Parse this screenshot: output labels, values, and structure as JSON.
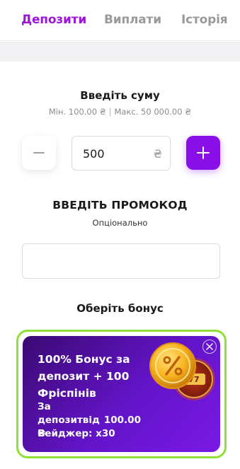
{
  "tabs": [
    {
      "label": "Депозити",
      "active": true
    },
    {
      "label": "Виплати",
      "active": false
    },
    {
      "label": "Історія",
      "active": false
    }
  ],
  "amount": {
    "title": "Введіть суму",
    "min_label": "Мін.  100.00 ₴",
    "max_label": "Макс.  50 000.00 ₴",
    "value": "500",
    "currency": "₴"
  },
  "promo": {
    "title": "ВВЕДІТЬ ПРОМОКОД",
    "subtitle": "Опціонально",
    "value": ""
  },
  "bonus": {
    "title": "Оберіть бонус",
    "card": {
      "title": "100% Бонус за депозит + 100 Фріспінів",
      "deposit_label": "За депозитвід",
      "deposit_amount": "100.00",
      "deposit_currency": "₴",
      "wager": "Вейджер: x30"
    }
  },
  "colors": {
    "accent": "#8a0ee8",
    "card_border": "#8fe035"
  }
}
